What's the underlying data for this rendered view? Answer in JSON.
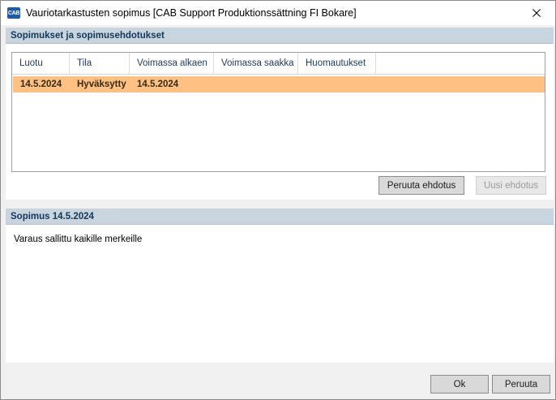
{
  "window": {
    "icon_text": "CAB",
    "title": "Vauriotarkastusten sopimus [CAB Support Produktionssättning FI Bokare]"
  },
  "agreements_section": {
    "title": "Sopimukset ja sopimusehdotukset",
    "columns": [
      "Luotu",
      "Tila",
      "Voimassa alkaen",
      "Voimassa saakka",
      "Huomautukset"
    ],
    "rows": [
      {
        "luotu": "14.5.2024",
        "tila": "Hyväksytty",
        "voimassa_alkaen": "14.5.2024",
        "voimassa_saakka": "",
        "huomautukset": ""
      }
    ],
    "cancel_proposal_label": "Peruuta ehdotus",
    "new_proposal_label": "Uusi ehdotus"
  },
  "detail_section": {
    "title": "Sopimus 14.5.2024",
    "note": "Varaus sallittu kaikille merkeille"
  },
  "footer": {
    "ok_label": "Ok",
    "cancel_label": "Peruuta"
  },
  "colors": {
    "section_header_bg": "#c8d4de",
    "selected_row_bg": "#ffc183"
  }
}
